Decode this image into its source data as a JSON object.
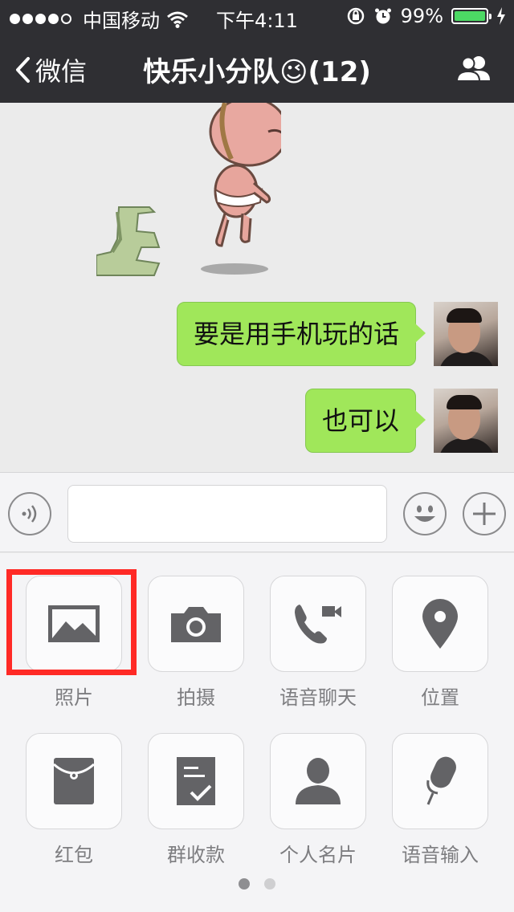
{
  "status_bar": {
    "carrier": "中国移动",
    "time": "下午4:11",
    "battery": "99%",
    "battery_level": 0.99,
    "signal_bars_filled": 4
  },
  "nav": {
    "back_label": "微信",
    "title": "快乐小分队😉(12)"
  },
  "messages": [
    {
      "text": "要是用手机玩的话",
      "sender": "self"
    },
    {
      "text": "也可以",
      "sender": "self"
    }
  ],
  "input": {
    "value": "",
    "placeholder": ""
  },
  "tools": [
    {
      "label": "照片",
      "icon": "photo-icon"
    },
    {
      "label": "拍摄",
      "icon": "camera-icon"
    },
    {
      "label": "语音聊天",
      "icon": "voice-call-icon"
    },
    {
      "label": "位置",
      "icon": "location-icon"
    },
    {
      "label": "红包",
      "icon": "red-packet-icon"
    },
    {
      "label": "群收款",
      "icon": "group-collect-icon"
    },
    {
      "label": "个人名片",
      "icon": "contact-card-icon"
    },
    {
      "label": "语音输入",
      "icon": "microphone-icon"
    }
  ],
  "pager": {
    "pages": 2,
    "current": 1
  },
  "colors": {
    "header": "#2f2f33",
    "bubble": "#a0e75a",
    "highlight": "#ff2a26",
    "icon": "#636366"
  }
}
